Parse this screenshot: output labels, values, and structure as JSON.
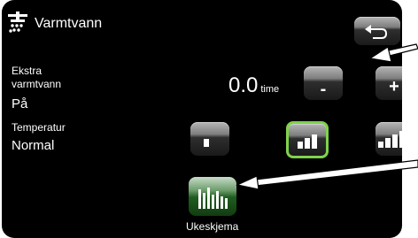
{
  "header": {
    "title": "Varmtvann",
    "icon": "hot-water-tap-icon"
  },
  "extra_hot_water": {
    "label": "Ekstra varmtvann",
    "status": "På",
    "hours": "0.0",
    "unit": "time",
    "minus_symbol": "-",
    "plus_symbol": "+"
  },
  "temperature": {
    "label": "Temperatur",
    "value": "Normal",
    "selected_level": "normal",
    "levels": [
      "low",
      "normal",
      "high"
    ]
  },
  "schedule": {
    "label": "Ukeskjema"
  },
  "colors": {
    "background": "#000000",
    "selected_border": "#7fd24c",
    "schedule_button": "#2f6f2f"
  }
}
